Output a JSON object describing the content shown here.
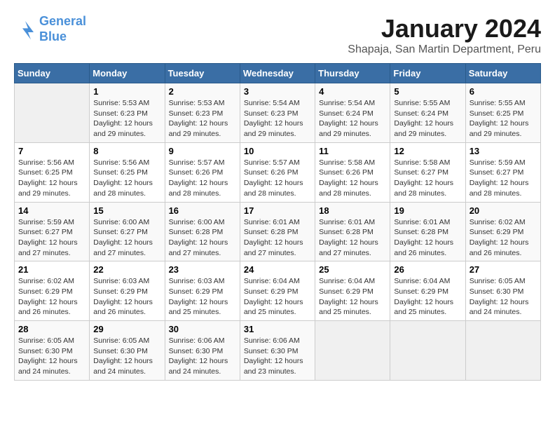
{
  "logo": {
    "line1": "General",
    "line2": "Blue"
  },
  "title": "January 2024",
  "subtitle": "Shapaja, San Martin Department, Peru",
  "days_of_week": [
    "Sunday",
    "Monday",
    "Tuesday",
    "Wednesday",
    "Thursday",
    "Friday",
    "Saturday"
  ],
  "weeks": [
    [
      {
        "day": "",
        "sunrise": "",
        "sunset": "",
        "daylight": ""
      },
      {
        "day": "1",
        "sunrise": "Sunrise: 5:53 AM",
        "sunset": "Sunset: 6:23 PM",
        "daylight": "Daylight: 12 hours and 29 minutes."
      },
      {
        "day": "2",
        "sunrise": "Sunrise: 5:53 AM",
        "sunset": "Sunset: 6:23 PM",
        "daylight": "Daylight: 12 hours and 29 minutes."
      },
      {
        "day": "3",
        "sunrise": "Sunrise: 5:54 AM",
        "sunset": "Sunset: 6:23 PM",
        "daylight": "Daylight: 12 hours and 29 minutes."
      },
      {
        "day": "4",
        "sunrise": "Sunrise: 5:54 AM",
        "sunset": "Sunset: 6:24 PM",
        "daylight": "Daylight: 12 hours and 29 minutes."
      },
      {
        "day": "5",
        "sunrise": "Sunrise: 5:55 AM",
        "sunset": "Sunset: 6:24 PM",
        "daylight": "Daylight: 12 hours and 29 minutes."
      },
      {
        "day": "6",
        "sunrise": "Sunrise: 5:55 AM",
        "sunset": "Sunset: 6:25 PM",
        "daylight": "Daylight: 12 hours and 29 minutes."
      }
    ],
    [
      {
        "day": "7",
        "sunrise": "Sunrise: 5:56 AM",
        "sunset": "Sunset: 6:25 PM",
        "daylight": "Daylight: 12 hours and 29 minutes."
      },
      {
        "day": "8",
        "sunrise": "Sunrise: 5:56 AM",
        "sunset": "Sunset: 6:25 PM",
        "daylight": "Daylight: 12 hours and 28 minutes."
      },
      {
        "day": "9",
        "sunrise": "Sunrise: 5:57 AM",
        "sunset": "Sunset: 6:26 PM",
        "daylight": "Daylight: 12 hours and 28 minutes."
      },
      {
        "day": "10",
        "sunrise": "Sunrise: 5:57 AM",
        "sunset": "Sunset: 6:26 PM",
        "daylight": "Daylight: 12 hours and 28 minutes."
      },
      {
        "day": "11",
        "sunrise": "Sunrise: 5:58 AM",
        "sunset": "Sunset: 6:26 PM",
        "daylight": "Daylight: 12 hours and 28 minutes."
      },
      {
        "day": "12",
        "sunrise": "Sunrise: 5:58 AM",
        "sunset": "Sunset: 6:27 PM",
        "daylight": "Daylight: 12 hours and 28 minutes."
      },
      {
        "day": "13",
        "sunrise": "Sunrise: 5:59 AM",
        "sunset": "Sunset: 6:27 PM",
        "daylight": "Daylight: 12 hours and 28 minutes."
      }
    ],
    [
      {
        "day": "14",
        "sunrise": "Sunrise: 5:59 AM",
        "sunset": "Sunset: 6:27 PM",
        "daylight": "Daylight: 12 hours and 27 minutes."
      },
      {
        "day": "15",
        "sunrise": "Sunrise: 6:00 AM",
        "sunset": "Sunset: 6:27 PM",
        "daylight": "Daylight: 12 hours and 27 minutes."
      },
      {
        "day": "16",
        "sunrise": "Sunrise: 6:00 AM",
        "sunset": "Sunset: 6:28 PM",
        "daylight": "Daylight: 12 hours and 27 minutes."
      },
      {
        "day": "17",
        "sunrise": "Sunrise: 6:01 AM",
        "sunset": "Sunset: 6:28 PM",
        "daylight": "Daylight: 12 hours and 27 minutes."
      },
      {
        "day": "18",
        "sunrise": "Sunrise: 6:01 AM",
        "sunset": "Sunset: 6:28 PM",
        "daylight": "Daylight: 12 hours and 27 minutes."
      },
      {
        "day": "19",
        "sunrise": "Sunrise: 6:01 AM",
        "sunset": "Sunset: 6:28 PM",
        "daylight": "Daylight: 12 hours and 26 minutes."
      },
      {
        "day": "20",
        "sunrise": "Sunrise: 6:02 AM",
        "sunset": "Sunset: 6:29 PM",
        "daylight": "Daylight: 12 hours and 26 minutes."
      }
    ],
    [
      {
        "day": "21",
        "sunrise": "Sunrise: 6:02 AM",
        "sunset": "Sunset: 6:29 PM",
        "daylight": "Daylight: 12 hours and 26 minutes."
      },
      {
        "day": "22",
        "sunrise": "Sunrise: 6:03 AM",
        "sunset": "Sunset: 6:29 PM",
        "daylight": "Daylight: 12 hours and 26 minutes."
      },
      {
        "day": "23",
        "sunrise": "Sunrise: 6:03 AM",
        "sunset": "Sunset: 6:29 PM",
        "daylight": "Daylight: 12 hours and 25 minutes."
      },
      {
        "day": "24",
        "sunrise": "Sunrise: 6:04 AM",
        "sunset": "Sunset: 6:29 PM",
        "daylight": "Daylight: 12 hours and 25 minutes."
      },
      {
        "day": "25",
        "sunrise": "Sunrise: 6:04 AM",
        "sunset": "Sunset: 6:29 PM",
        "daylight": "Daylight: 12 hours and 25 minutes."
      },
      {
        "day": "26",
        "sunrise": "Sunrise: 6:04 AM",
        "sunset": "Sunset: 6:29 PM",
        "daylight": "Daylight: 12 hours and 25 minutes."
      },
      {
        "day": "27",
        "sunrise": "Sunrise: 6:05 AM",
        "sunset": "Sunset: 6:30 PM",
        "daylight": "Daylight: 12 hours and 24 minutes."
      }
    ],
    [
      {
        "day": "28",
        "sunrise": "Sunrise: 6:05 AM",
        "sunset": "Sunset: 6:30 PM",
        "daylight": "Daylight: 12 hours and 24 minutes."
      },
      {
        "day": "29",
        "sunrise": "Sunrise: 6:05 AM",
        "sunset": "Sunset: 6:30 PM",
        "daylight": "Daylight: 12 hours and 24 minutes."
      },
      {
        "day": "30",
        "sunrise": "Sunrise: 6:06 AM",
        "sunset": "Sunset: 6:30 PM",
        "daylight": "Daylight: 12 hours and 24 minutes."
      },
      {
        "day": "31",
        "sunrise": "Sunrise: 6:06 AM",
        "sunset": "Sunset: 6:30 PM",
        "daylight": "Daylight: 12 hours and 23 minutes."
      },
      {
        "day": "",
        "sunrise": "",
        "sunset": "",
        "daylight": ""
      },
      {
        "day": "",
        "sunrise": "",
        "sunset": "",
        "daylight": ""
      },
      {
        "day": "",
        "sunrise": "",
        "sunset": "",
        "daylight": ""
      }
    ]
  ]
}
